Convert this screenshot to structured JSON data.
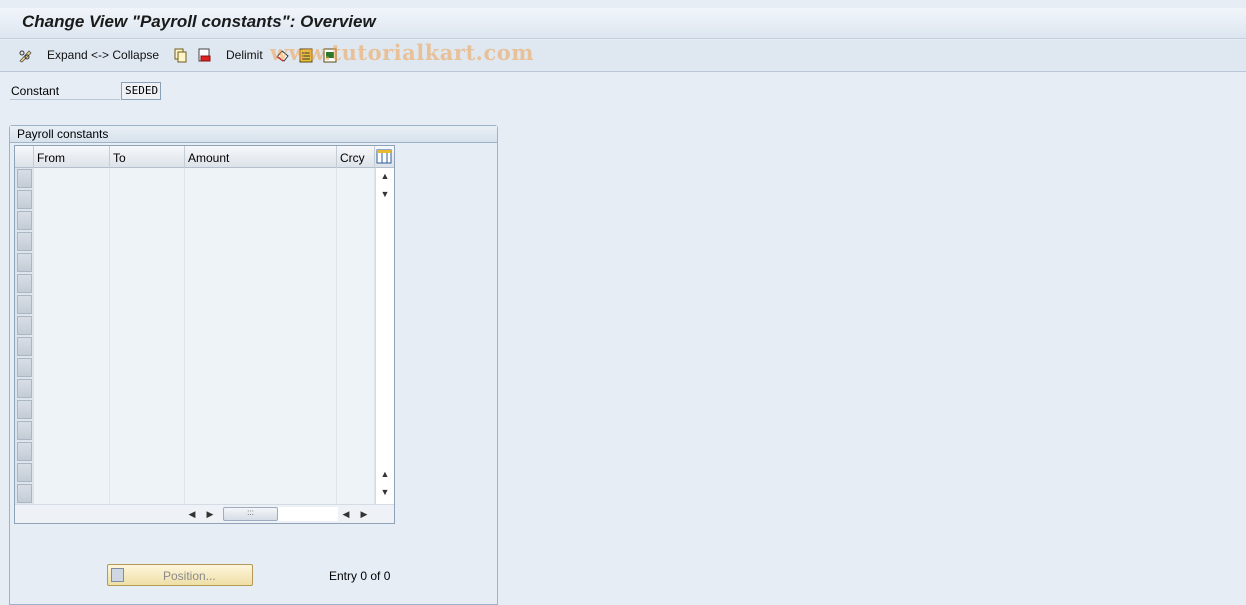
{
  "window": {
    "title": "Change View \"Payroll constants\": Overview"
  },
  "toolbar": {
    "expand_collapse_label": "Expand <-> Collapse",
    "delimit_label": "Delimit",
    "watermark": "www.tutorialkart.com"
  },
  "constant_field": {
    "label": "Constant",
    "value": "SEDED"
  },
  "group": {
    "title": "Payroll constants"
  },
  "table": {
    "columns": [
      "From",
      "To",
      "Amount",
      "Crcy"
    ],
    "rows": []
  },
  "footer": {
    "position_button": "Position...",
    "entry_text": "Entry 0 of 0"
  },
  "colors": {
    "accent": "#e6edf5",
    "position_button": "#efdfa6"
  }
}
